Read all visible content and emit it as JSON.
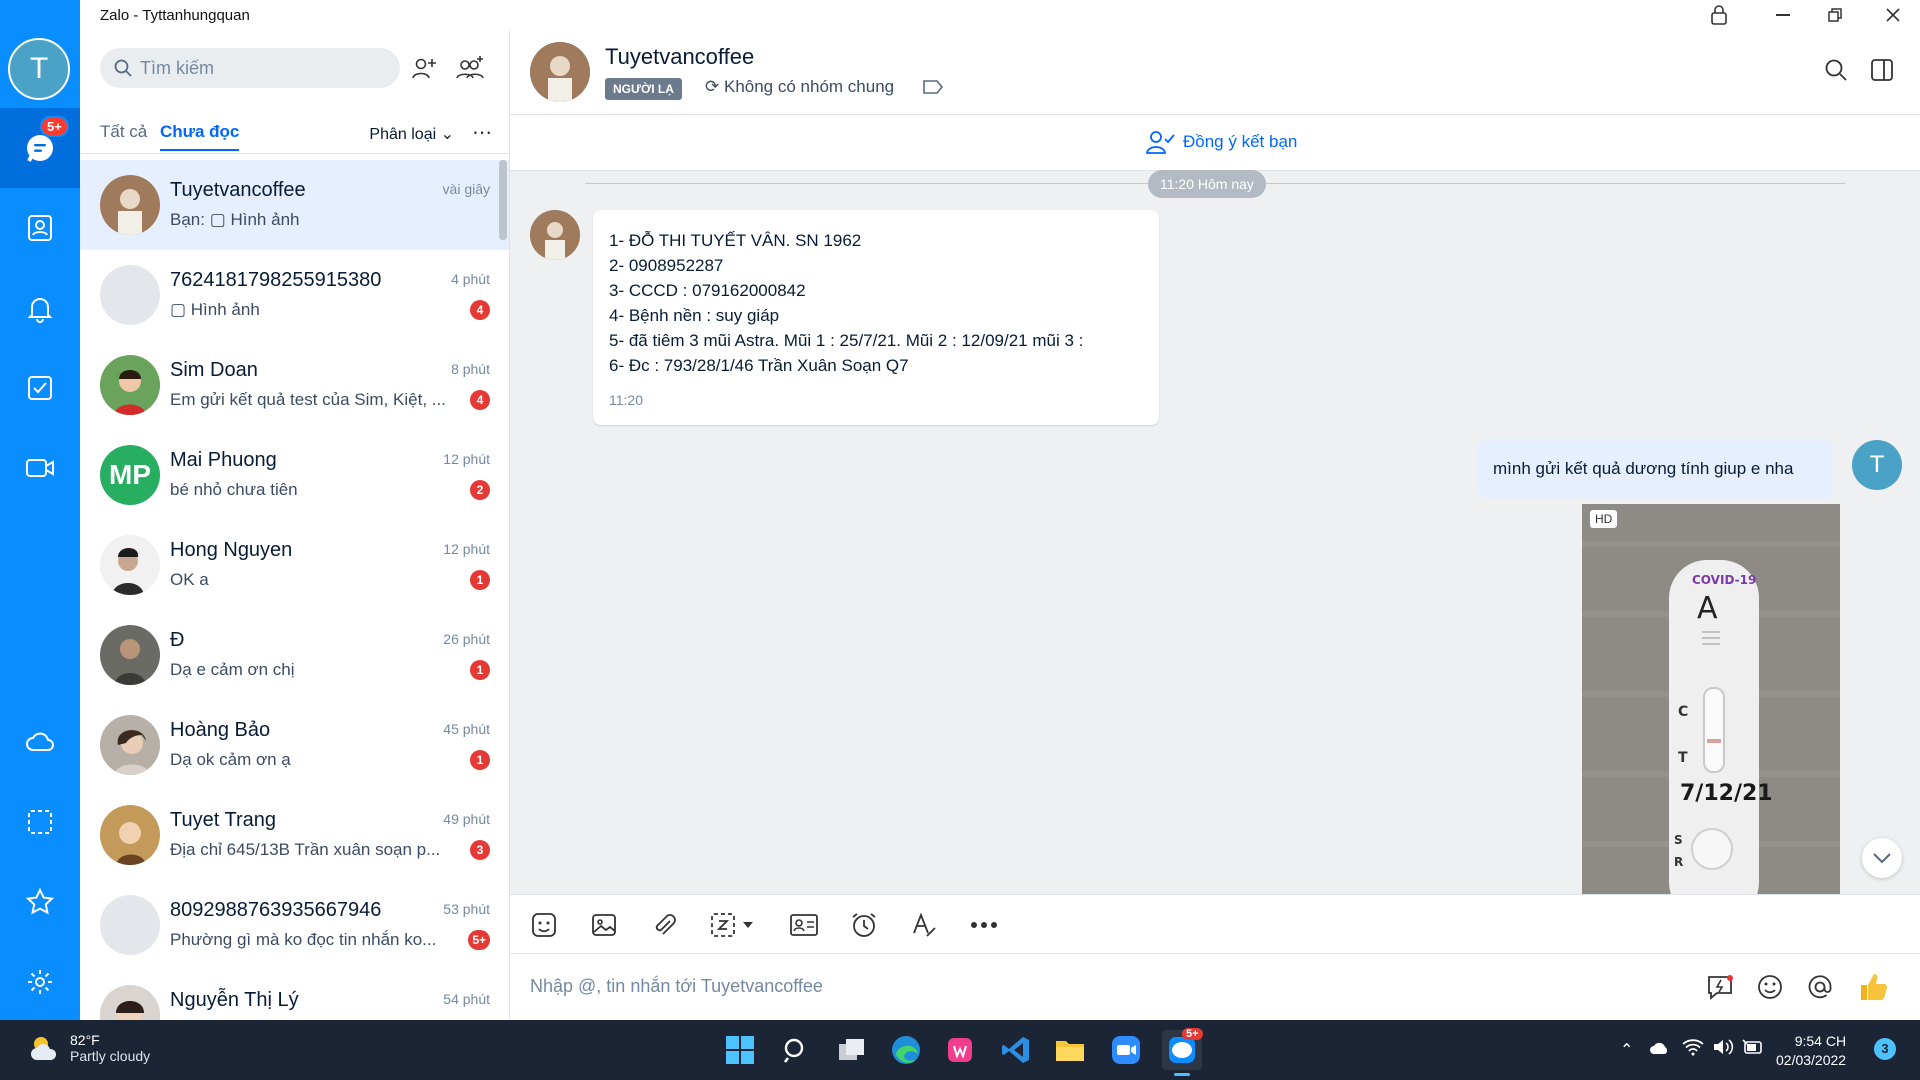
{
  "app": {
    "window_title": "Zalo - Tyttanhungquan"
  },
  "nav": {
    "avatar_letter": "T",
    "messages_badge": "5+"
  },
  "search": {
    "placeholder": "Tìm kiếm"
  },
  "tabs": {
    "all": "Tất cả",
    "unread": "Chưa đọc",
    "filter": "Phân loại"
  },
  "conversations": [
    {
      "name": "Tuyetvancoffee",
      "preview": "Bạn: ▢ Hình ảnh",
      "time": "vài giây",
      "count": ""
    },
    {
      "name": "7624181798255915380",
      "preview": "▢ Hình ảnh",
      "time": "4 phút",
      "count": "4"
    },
    {
      "name": "Sim Doan",
      "preview": "Em gửi kết quả test của Sim, Kiệt, ...",
      "time": "8 phút",
      "count": "4"
    },
    {
      "name": "Mai Phuong",
      "preview": "bé nhỏ chưa tiên",
      "time": "12 phút",
      "count": "2",
      "initials": "MP"
    },
    {
      "name": "Hong Nguyen",
      "preview": "OK a",
      "time": "12 phút",
      "count": "1"
    },
    {
      "name": "Đ",
      "preview": "Dạ e cảm ơn chị",
      "time": "26 phút",
      "count": "1"
    },
    {
      "name": "Hoàng Bảo",
      "preview": "Dạ ok cảm ơn ạ",
      "time": "45 phút",
      "count": "1"
    },
    {
      "name": "Tuyet Trang",
      "preview": "Địa chỉ 645/13B Trần xuân soạn p...",
      "time": "49 phút",
      "count": "3"
    },
    {
      "name": "8092988763935667946",
      "preview": "Phường gì mà ko đọc tin nhắn ko...",
      "time": "53 phút",
      "count": "5+"
    },
    {
      "name": "Nguyễn Thị Lý",
      "preview": "",
      "time": "54 phút",
      "count": ""
    }
  ],
  "chat": {
    "name": "Tuyetvancoffee",
    "tag": "NGƯỜI LẠ",
    "group_status": "Không có nhóm chung",
    "accept_friend": "Đồng ý kết bạn",
    "date_divider": "11:20 Hôm nay",
    "incoming": {
      "lines": [
        "1- ĐỖ THI TUYẾT VÂN. SN 1962",
        "2- 0908952287",
        "3- CCCD : 079162000842",
        "4- Bệnh nền : suy giáp",
        "5- đã tiêm 3 mũi Astra. Mũi 1 : 25/7/21. Mũi 2 : 12/09/21  mũi 3 :",
        "6- Đc : 793/28/1/46 Trần Xuân Soạn Q7"
      ],
      "time": "11:20"
    },
    "outgoing_text": "mình gửi kết quả dương tính giup e nha",
    "photo_badge": "HD",
    "photo_texts": {
      "label": "COVID-19",
      "letter": "A",
      "c": "C",
      "t": "T",
      "date": "7/12/21",
      "s": "S",
      "r": "R"
    },
    "my_avatar_letter": "T",
    "input_placeholder": "Nhập @, tin nhắn tới Tuyetvancoffee"
  },
  "taskbar": {
    "temp": "82°F",
    "weather": "Partly cloudy",
    "time": "9:54 CH",
    "date": "02/03/2022",
    "zalo_badge": "5+",
    "notif_count": "3"
  },
  "colors": {
    "brand_blue": "#0a8dff",
    "selected_row": "#e5efff",
    "badge_red": "#e53935",
    "chat_bg": "#eef0f1"
  }
}
